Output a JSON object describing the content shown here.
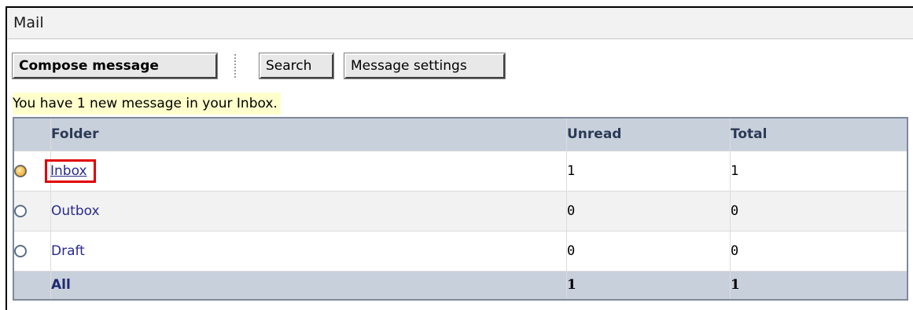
{
  "header": {
    "title": "Mail"
  },
  "toolbar": {
    "compose_label": "Compose message",
    "search_label": "Search",
    "settings_label": "Message settings"
  },
  "notice": "You have 1 new message in your Inbox.",
  "table": {
    "headers": {
      "folder": "Folder",
      "unread": "Unread",
      "total": "Total"
    },
    "rows": [
      {
        "folder": "Inbox",
        "unread": "1",
        "total": "1",
        "icon": "radio-selected-icon"
      },
      {
        "folder": "Outbox",
        "unread": "0",
        "total": "0",
        "icon": "radio-icon"
      },
      {
        "folder": "Draft",
        "unread": "0",
        "total": "0",
        "icon": "radio-icon"
      }
    ],
    "summary": {
      "label": "All",
      "unread": "1",
      "total": "1"
    }
  },
  "colors": {
    "header_bg": "#c8d0dc",
    "notice_bg": "#ffffcc",
    "highlight": "#e00000",
    "link": "#2a2a8c"
  }
}
